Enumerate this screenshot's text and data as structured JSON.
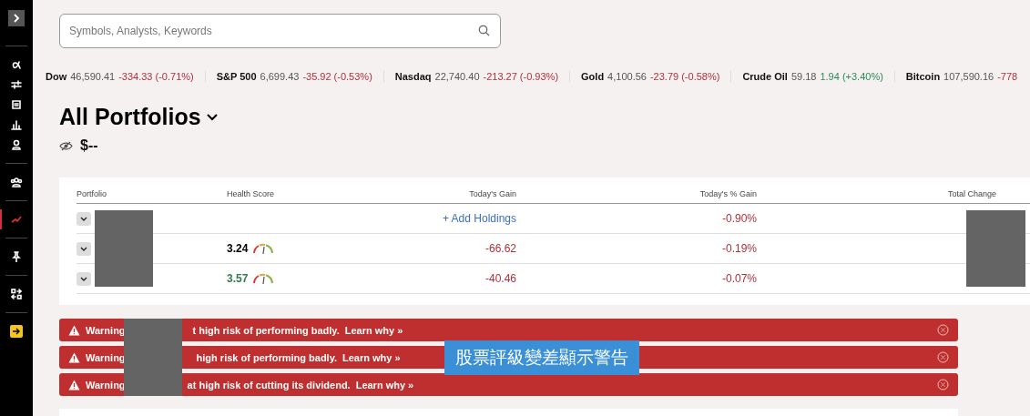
{
  "sidebar": {
    "items": [
      {
        "selected": false
      },
      {
        "selected": false
      },
      {
        "selected": false
      },
      {
        "selected": false
      },
      {
        "selected": false
      },
      {
        "selected": false
      },
      {
        "selected": true
      },
      {
        "selected": false
      },
      {
        "selected": false
      },
      {
        "selected": false
      }
    ]
  },
  "search": {
    "placeholder": "Symbols, Analysts, Keywords"
  },
  "ticker": [
    {
      "name": "Dow",
      "value": "46,590.41",
      "change": "-334.33 (-0.71%)",
      "positive": false
    },
    {
      "name": "S&P 500",
      "value": "6,699.43",
      "change": "-35.92 (-0.53%)",
      "positive": false
    },
    {
      "name": "Nasdaq",
      "value": "22,740.40",
      "change": "-213.27 (-0.93%)",
      "positive": false
    },
    {
      "name": "Gold",
      "value": "4,100.56",
      "change": "-23.79 (-0.58%)",
      "positive": false
    },
    {
      "name": "Crude Oil",
      "value": "59.18",
      "change": "1.94 (+3.40%)",
      "positive": true
    },
    {
      "name": "Bitcoin",
      "value": "107,590.16",
      "change": "-778",
      "positive": false
    }
  ],
  "portfolio": {
    "title": "All Portfolios",
    "balance": "$--"
  },
  "table": {
    "columns": [
      "Portfolio",
      "Health Score",
      "Today's Gain",
      "Today's % Gain",
      "Total Change"
    ],
    "rows": [
      {
        "kind": "link",
        "gain": "+ Add Holdings",
        "pct": "-0.90%"
      },
      {
        "kind": "value",
        "score": "3.24",
        "positive": false,
        "gain": "-66.62",
        "pct": "-0.19%"
      },
      {
        "kind": "value",
        "score": "3.57",
        "positive": true,
        "gain": "-40.46",
        "pct": "-0.07%"
      }
    ]
  },
  "warnings": [
    {
      "lead": "Warning",
      "text": "t high risk of performing badly.",
      "link": "Learn why »"
    },
    {
      "lead": "Warning",
      "text": "high risk of performing badly.",
      "link": "Learn why »"
    },
    {
      "lead": "Warning",
      "text": "at high risk of cutting its dividend.",
      "link": "Learn why »"
    }
  ],
  "annotation": "股票評級變差顯示警告"
}
